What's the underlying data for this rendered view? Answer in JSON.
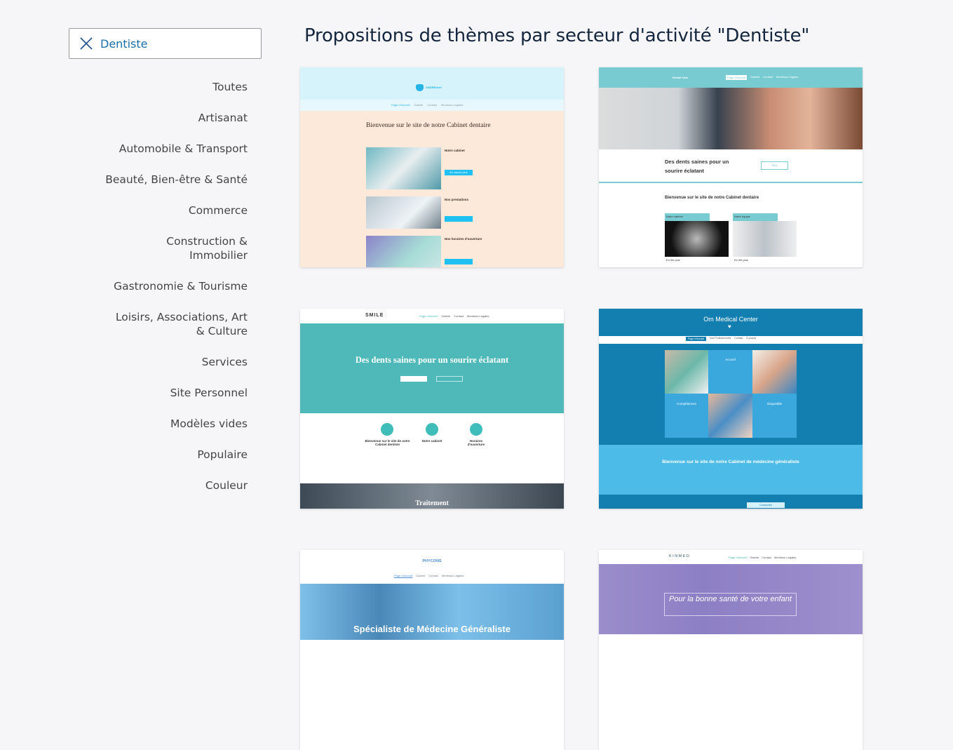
{
  "filter": {
    "label": "Dentiste",
    "clear_icon": "close-icon"
  },
  "categories": [
    "Toutes",
    "Artisanat",
    "Automobile & Transport",
    "Beauté, Bien-être & Santé",
    "Commerce",
    "Construction & Immobilier",
    "Gastronomie & Tourisme",
    "Loisirs, Associations, Art & Culture",
    "Services",
    "Site Personnel",
    "Modèles vides",
    "Populaire",
    "Couleur"
  ],
  "title": "Propositions de thèmes par secteur d'activité \"Dentiste\"",
  "themes": [
    {
      "logo": "ANDREdent",
      "nav": [
        "Page d'Accueil",
        "Galerie",
        "Contact",
        "Mentions Légales"
      ],
      "heading": "Bienvenue sur le site de notre Cabinet dentaire",
      "sections": [
        "Notre cabinet",
        "Nos prestations",
        "Nos horaires d'ouverture"
      ],
      "button": "En savoir plus"
    },
    {
      "logo": "Dental Care",
      "nav": [
        "Page d'Accueil",
        "Galerie",
        "Contact",
        "Mentions Légales"
      ],
      "heading": "Des dents saines pour un sourire éclatant",
      "cta": "Plus",
      "subheading": "Bienvenue sur le site de notre Cabinet dentaire",
      "cards": [
        "Notre cabinet",
        "Notre équipe"
      ],
      "more": "En lire plus"
    },
    {
      "logo": "SMILE",
      "nav": [
        "Page d'Accueil",
        "Galerie",
        "Contact",
        "Mentions Légales"
      ],
      "heading": "Des dents saines pour un sourire éclatant",
      "features": [
        "Bienvenue sur le site de notre Cabinet dentiste",
        "Notre cabinet",
        "Horaires d'ouverture"
      ],
      "footer": "Traitement"
    },
    {
      "logo": "Om Medical Center",
      "nav": [
        "Page d'Accueil",
        "Nos Professionnels",
        "Contact",
        "À propos"
      ],
      "tiles": [
        "Accueil",
        "Compétences",
        "Disponible"
      ],
      "heading": "Bienvenue sur le site de notre Cabinet de médecine généraliste",
      "button": "Contactez"
    },
    {
      "logo": "PHYCONS",
      "nav": [
        "Page d'Accueil",
        "Galerie",
        "Contact",
        "Mentions Légales"
      ],
      "heading": "Spécialiste de Médecine Généraliste"
    },
    {
      "logo": "KINMED",
      "nav": [
        "Page d'Accueil",
        "Galerie",
        "Contact",
        "Mentions Légales"
      ],
      "heading": "Pour la bonne santé de votre enfant"
    }
  ]
}
